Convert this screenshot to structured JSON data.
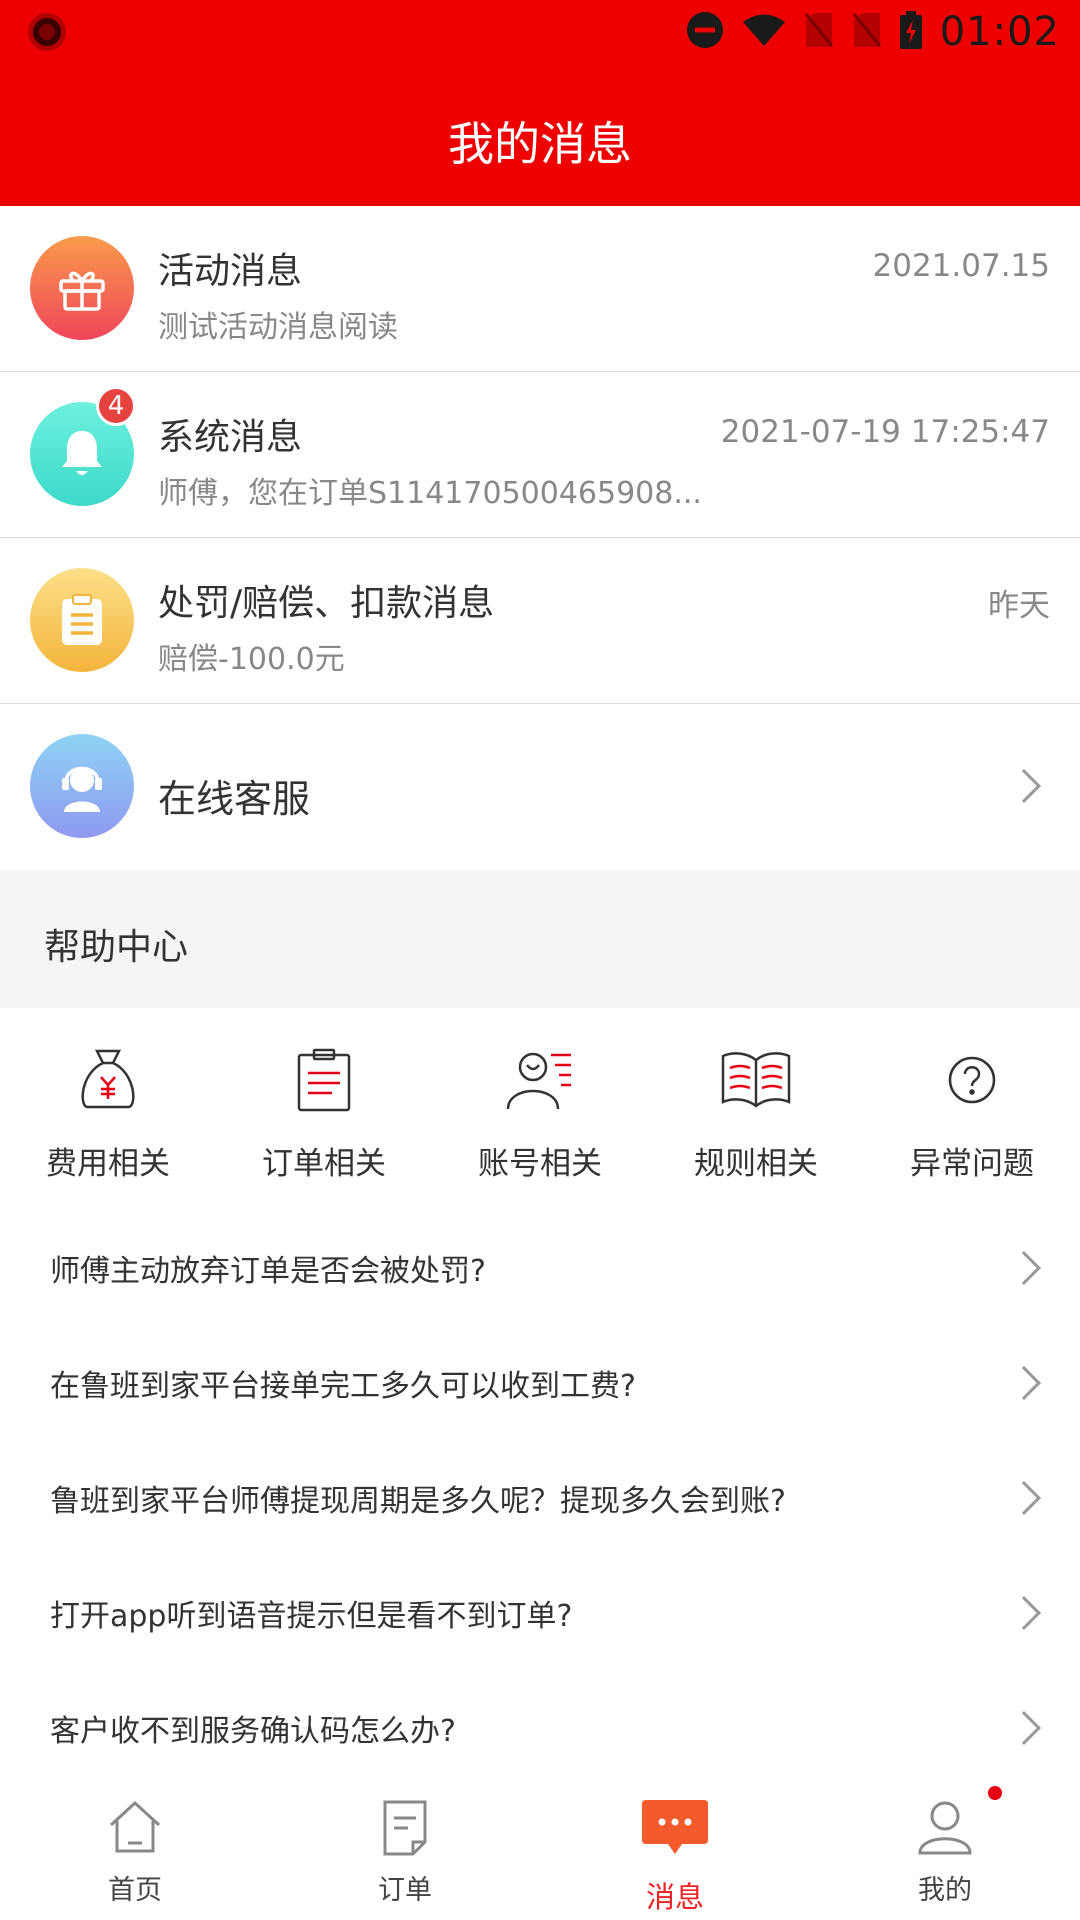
{
  "status_bar": {
    "time": "01:02",
    "icons": [
      "record-icon",
      "do-not-disturb-icon",
      "wifi-icon",
      "no-sim-icon",
      "no-sim-icon",
      "battery-charging-icon"
    ]
  },
  "header": {
    "title": "我的消息"
  },
  "messages": [
    {
      "icon": "gift-icon",
      "title": "活动消息",
      "subtitle": "测试活动消息阅读",
      "time": "2021.07.15"
    },
    {
      "icon": "bell-icon",
      "title": "系统消息",
      "subtitle": "师傅，您在订单S114170500465908...",
      "time": "2021-07-19 17:25:47",
      "badge": "4"
    },
    {
      "icon": "clipboard-icon",
      "title": "处罚/赔偿、扣款消息",
      "subtitle": "赔偿-100.0元",
      "time": "昨天"
    },
    {
      "icon": "customer-service-icon",
      "title": "在线客服"
    }
  ],
  "help": {
    "title": "帮助中心",
    "categories": [
      {
        "icon": "money-bag-icon",
        "label": "费用相关"
      },
      {
        "icon": "clipboard-list-icon",
        "label": "订单相关"
      },
      {
        "icon": "account-icon",
        "label": "账号相关"
      },
      {
        "icon": "book-icon",
        "label": "规则相关"
      },
      {
        "icon": "question-icon",
        "label": "异常问题"
      }
    ],
    "faqs": [
      "师傅主动放弃订单是否会被处罚?",
      "在鲁班到家平台接单完工多久可以收到工费?",
      "鲁班到家平台师傅提现周期是多久呢？提现多久会到账?",
      "打开app听到语音提示但是看不到订单?",
      "客户收不到服务确认码怎么办?"
    ]
  },
  "tabbar": {
    "items": [
      {
        "icon": "home-icon",
        "label": "首页"
      },
      {
        "icon": "order-icon",
        "label": "订单"
      },
      {
        "icon": "message-icon",
        "label": "消息",
        "active": true
      },
      {
        "icon": "profile-icon",
        "label": "我的",
        "dot": true
      }
    ]
  },
  "colors": {
    "brand_red": "#ee0000",
    "active_tab": "#ee2222",
    "badge": "#e64340"
  }
}
